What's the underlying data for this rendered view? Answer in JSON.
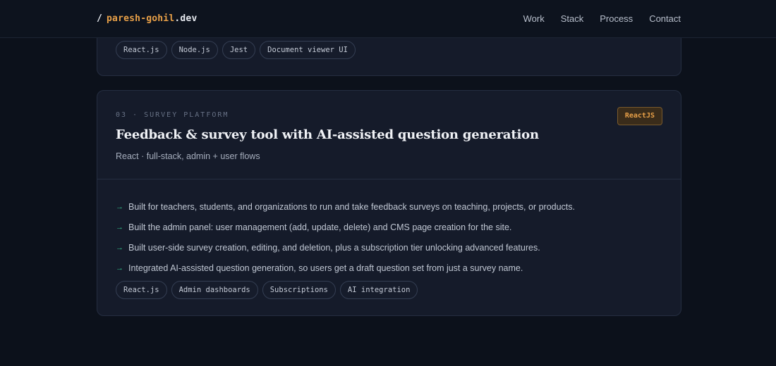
{
  "header": {
    "brand_slash": "/",
    "brand_name": "paresh-gohil",
    "brand_tld": ".dev",
    "nav": [
      "Work",
      "Stack",
      "Process",
      "Contact"
    ]
  },
  "card_prev": {
    "tags": [
      "React.js",
      "Node.js",
      "Jest",
      "Document viewer UI"
    ]
  },
  "card_main": {
    "kicker": "03 · SURVEY PLATFORM",
    "badge": "ReactJS",
    "title": "Feedback & survey tool with AI-assisted question generation",
    "subtitle": "React · full-stack, admin + user flows",
    "bullets": [
      "Built for teachers, students, and organizations to run and take feedback surveys on teaching, projects, or products.",
      "Built the admin panel: user management (add, update, delete) and CMS page creation for the site.",
      "Built user-side survey creation, editing, and deletion, plus a subscription tier unlocking advanced features.",
      "Integrated AI-assisted question generation, so users get a draft question set from just a survey name."
    ],
    "bullet_icon": "arrow-right-icon",
    "tags": [
      "React.js",
      "Admin dashboards",
      "Subscriptions",
      "AI integration"
    ]
  },
  "colors": {
    "background": "#0c111b",
    "card": "#151b2a",
    "accent": "#e8a048",
    "bullet": "#34c28a"
  }
}
